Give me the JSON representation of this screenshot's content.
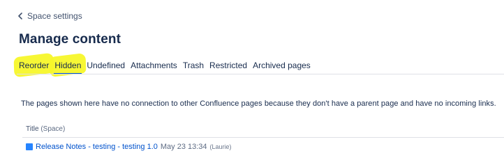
{
  "nav": {
    "back_label": "Space settings"
  },
  "page": {
    "title": "Manage content"
  },
  "tabs": [
    {
      "label": "Reorder"
    },
    {
      "label": "Hidden"
    },
    {
      "label": "Undefined"
    },
    {
      "label": "Attachments"
    },
    {
      "label": "Trash"
    },
    {
      "label": "Restricted"
    },
    {
      "label": "Archived pages"
    }
  ],
  "content": {
    "description": "The pages shown here have no connection to other Confluence pages because they don't have a parent page and have no incoming links."
  },
  "table": {
    "column_title": "Title",
    "column_title_sub": "(Space)",
    "rows": [
      {
        "title": "Release Notes - testing - testing 1.0",
        "date": "May 23 13:34",
        "author": "(Laurie)"
      }
    ]
  },
  "colors": {
    "highlight": "#f7f72a",
    "active_tab_underline": "#0052cc",
    "link": "#0052cc",
    "page_icon": "#2684ff"
  },
  "icons": {
    "back": "chevron-left-icon",
    "page": "page-icon"
  }
}
